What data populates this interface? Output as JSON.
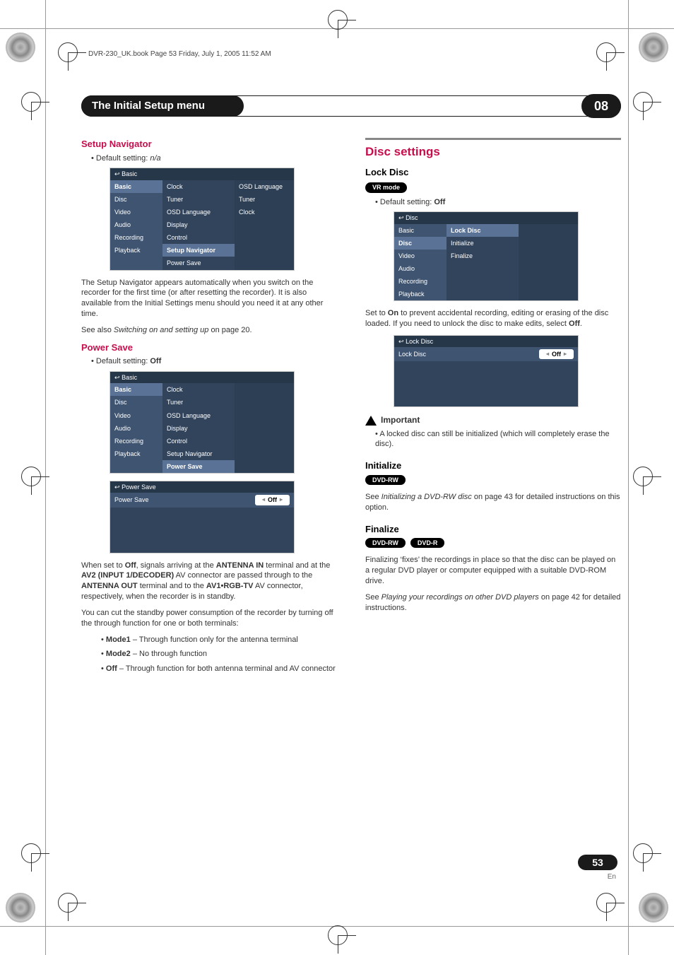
{
  "header_path": "DVR-230_UK.book  Page 53  Friday, July 1, 2005  11:52 AM",
  "lozenge_title": "The Initial Setup menu",
  "chapter_number": "08",
  "page_number": "53",
  "page_lang": "En",
  "left": {
    "setup_nav_h": "Setup Navigator",
    "setup_nav_default": "Default setting: ",
    "setup_nav_default_val": "n/a",
    "osd1_title": "Basic",
    "osd_nav": [
      "Basic",
      "Disc",
      "Video",
      "Audio",
      "Recording",
      "Playback"
    ],
    "osd1_list": [
      "Clock",
      "Tuner",
      "OSD Language",
      "Display",
      "Control",
      "Setup Navigator",
      "Power Save"
    ],
    "osd1_extra": [
      "OSD Language",
      "Tuner",
      "Clock"
    ],
    "setup_nav_p1a": "The Setup Navigator appears automatically when you switch on the recorder for the first time (or after resetting the recorder). It is also available from the Initial Settings menu should you need it at any other time.",
    "setup_nav_p2_pre": "See also ",
    "setup_nav_p2_em": "Switching on and setting up",
    "setup_nav_p2_post": " on page 20.",
    "power_save_h": "Power Save",
    "power_save_default": "Default setting: ",
    "power_save_default_val": "Off",
    "osd2_title": "Basic",
    "osd2_list": [
      "Clock",
      "Tuner",
      "OSD Language",
      "Display",
      "Control",
      "Setup Navigator",
      "Power Save"
    ],
    "osd3_title": "Power Save",
    "osd3_row_label": "Power Save",
    "osd3_row_value": "Off",
    "ps_p1_a": "When set to ",
    "ps_p1_off": "Off",
    "ps_p1_b": ", signals arriving at the ",
    "ps_p1_c": "ANTENNA IN",
    "ps_p1_d": " terminal and at the ",
    "ps_p1_e": "AV2 (INPUT 1/DECODER)",
    "ps_p1_f": " AV connector are passed through to the ",
    "ps_p1_g": "ANTENNA OUT",
    "ps_p1_h": " terminal and to the ",
    "ps_p1_i": "AV1•RGB-TV",
    "ps_p1_j": " AV connector, respectively, when the recorder is in standby.",
    "ps_p2": "You can cut the standby power consumption of the recorder by turning off the through function for one or both terminals:",
    "ps_m1_b": "Mode1",
    "ps_m1_t": " – Through function only for the antenna terminal",
    "ps_m2_b": "Mode2",
    "ps_m2_t": " – No through function",
    "ps_off_b": "Off",
    "ps_off_t": " – Through function for both antenna terminal and AV connector"
  },
  "right": {
    "disc_settings_h": "Disc settings",
    "lock_h": "Lock Disc",
    "badge_vr": "VR mode",
    "lock_default": "Default setting: ",
    "lock_default_val": "Off",
    "osd4_title": "Disc",
    "osd4_list": [
      "Lock Disc",
      "Initialize",
      "Finalize"
    ],
    "lock_p1_a": "Set to ",
    "lock_p1_on": "On",
    "lock_p1_b": " to prevent accidental recording, editing or erasing of the disc loaded. If you need to unlock the disc to make edits, select ",
    "lock_p1_off": "Off",
    "lock_p1_c": ".",
    "osd5_title": "Lock Disc",
    "osd5_row_label": "Lock Disc",
    "osd5_row_value": "Off",
    "important_h": "Important",
    "important_b": "A locked disc can still be initialized (which will completely erase the disc).",
    "init_h": "Initialize",
    "badge_dvd_rw": "DVD-RW",
    "init_p_pre": "See ",
    "init_p_em": "Initializing a DVD-RW disc",
    "init_p_post": " on page 43 for detailed instructions on this option.",
    "finalize_h": "Finalize",
    "badge_dvd_r": "DVD-R",
    "fin_p1": "Finalizing ‘fixes’ the recordings in place so that the disc can be played on a regular DVD player or computer equipped with a suitable DVD-ROM drive.",
    "fin_p2_pre": "See ",
    "fin_p2_em": "Playing your recordings on other DVD players",
    "fin_p2_post": " on page 42 for detailed instructions."
  }
}
